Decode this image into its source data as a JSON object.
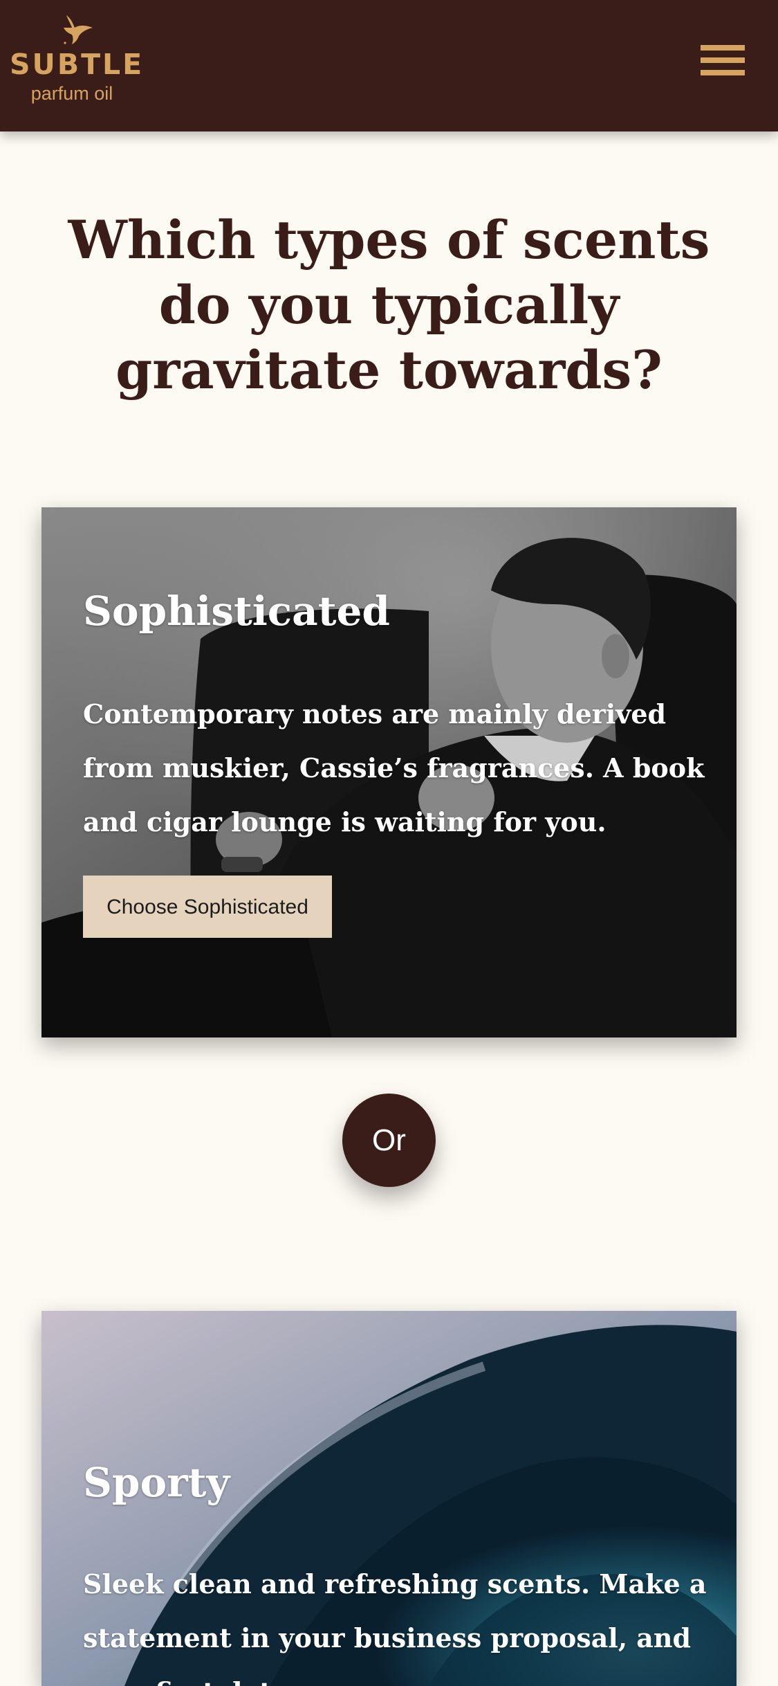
{
  "brand": {
    "name": "SUBTLE",
    "tagline": "parfum oil",
    "icon": "bird-logo-icon"
  },
  "header": {
    "menu_icon": "hamburger-menu-icon"
  },
  "colors": {
    "header_bg": "#3A1D18",
    "accent_gold": "#D6A45E",
    "page_bg": "#FDF9F3",
    "button_bg": "#E6D3BE"
  },
  "quiz": {
    "question": "Which types of scents do you typically gravitate towards?",
    "separator": "Or",
    "options": [
      {
        "title": "Sophisticated",
        "description": "Contemporary notes are mainly derived from muskier, Cassie’s fragrances. A book and cigar lounge is waiting for you.",
        "button_label": "Choose Sophisticated"
      },
      {
        "title": "Sporty",
        "description": "Sleek clean and refreshing scents. Make a statement in your business proposal, and on a first date."
      }
    ]
  }
}
